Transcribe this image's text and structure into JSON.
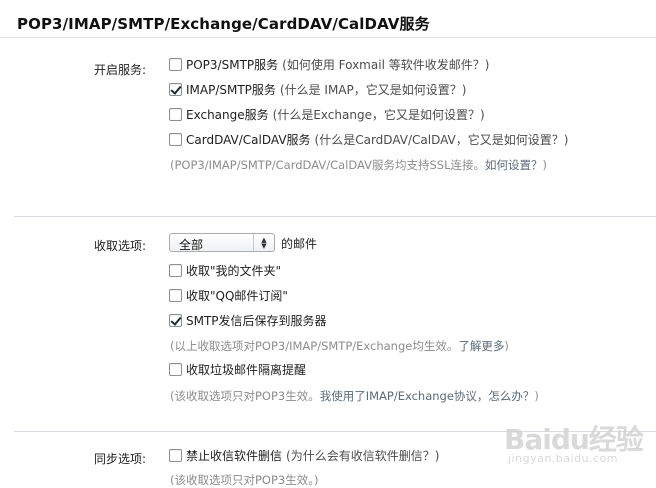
{
  "header": {
    "title": "POP3/IMAP/SMTP/Exchange/CardDAV/CalDAV服务"
  },
  "services": {
    "label": "开启服务:",
    "items": [
      {
        "label": "POP3/SMTP服务",
        "hint": "(如何使用 Foxmail 等软件收发邮件？)",
        "checked": false
      },
      {
        "label": "IMAP/SMTP服务",
        "hint": "(什么是 IMAP，它又是如何设置？)",
        "checked": true
      },
      {
        "label": "Exchange服务",
        "hint": "(什么是Exchange，它又是如何设置？)",
        "checked": false
      },
      {
        "label": "CardDAV/CalDAV服务",
        "hint": "(什么是CardDAV/CalDAV，它又是如何设置？)",
        "checked": false
      }
    ],
    "note_prefix": "(POP3/IMAP/SMTP/CardDAV/CalDAV服务均支持SSL连接。",
    "note_link": "如何设置？",
    "note_suffix": ")"
  },
  "receive": {
    "label": "收取选项:",
    "select_value": "全部",
    "select_suffix": "的邮件",
    "items": [
      {
        "label": "收取\"我的文件夹\"",
        "checked": false
      },
      {
        "label": "收取\"QQ邮件订阅\"",
        "checked": false
      },
      {
        "label": "SMTP发信后保存到服务器",
        "checked": true
      }
    ],
    "note1_prefix": "(以上收取选项对POP3/IMAP/SMTP/Exchange均生效。",
    "note1_link": "了解更多",
    "note1_suffix": ")",
    "spam_item": {
      "label": "收取垃圾邮件隔离提醒",
      "checked": false
    },
    "note2_prefix": "(该收取选项只对POP3生效。",
    "note2_link": "我使用了IMAP/Exchange协议，怎么办？",
    "note2_suffix": ")"
  },
  "sync": {
    "label": "同步选项:",
    "item": {
      "label": "禁止收信软件删信",
      "hint": "(为什么会有收信软件删信？)",
      "checked": false
    },
    "note": "(该收取选项只对POP3生效。)"
  },
  "watermark": {
    "main": "Baidu经验",
    "sub": "jingyan.baidu.com"
  }
}
